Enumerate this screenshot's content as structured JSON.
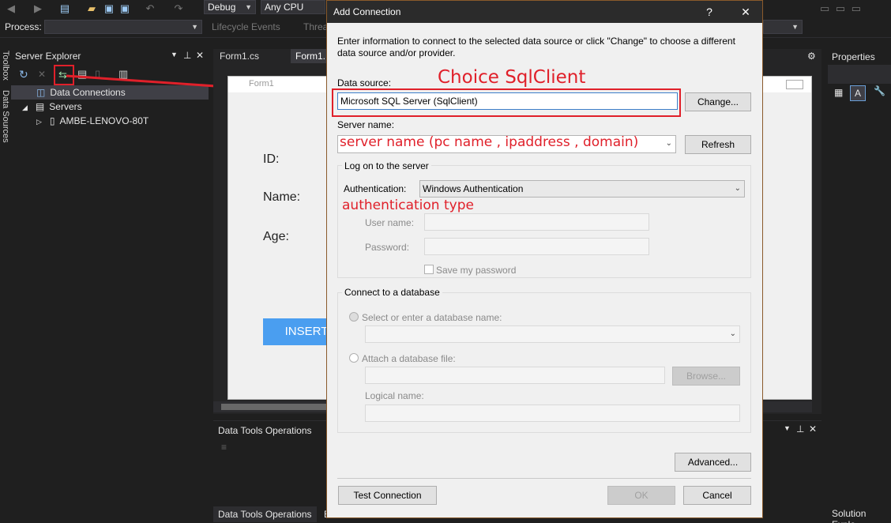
{
  "toolbar": {
    "config": "Debug",
    "platform": "Any CPU",
    "process_label": "Process:",
    "lifecycle": "Lifecycle Events",
    "thread": "Threa"
  },
  "sidebar": {
    "toolbox": "Toolbox",
    "data_sources": "Data Sources"
  },
  "server_explorer": {
    "title": "Server Explorer",
    "items": [
      {
        "label": "Data Connections"
      },
      {
        "label": "Servers"
      },
      {
        "label": "AMBE-LENOVO-80T"
      }
    ]
  },
  "designer": {
    "tabs": [
      "Form1.cs",
      "Form1."
    ],
    "form_title": "Form1",
    "labels": {
      "id": "ID:",
      "name": "Name:",
      "age": "Age:"
    },
    "insert_button": "INSERT"
  },
  "data_tools": {
    "title": "Data Tools Operations",
    "bottom_tab": "Data Tools Operations",
    "bottom_tab2": "E"
  },
  "properties": {
    "title": "Properties",
    "solution": "Solution Explo"
  },
  "dialog": {
    "title": "Add Connection",
    "help": "?",
    "close": "✕",
    "description": "Enter information to connect to the selected data source or click \"Change\" to choose a different data source and/or provider.",
    "data_source_label": "Data source:",
    "data_source_value": "Microsoft SQL Server (SqlClient)",
    "change_button": "Change...",
    "server_name_label": "Server name:",
    "refresh_button": "Refresh",
    "logon_group": "Log on to the server",
    "auth_label": "Authentication:",
    "auth_value": "Windows Authentication",
    "username_label": "User name:",
    "password_label": "Password:",
    "save_password": "Save my password",
    "connect_group": "Connect to a database",
    "select_db_label": "Select or enter a database name:",
    "attach_label": "Attach a database file:",
    "browse_button": "Browse...",
    "logical_name_label": "Logical name:",
    "advanced_button": "Advanced...",
    "test_button": "Test Connection",
    "ok_button": "OK",
    "cancel_button": "Cancel"
  },
  "annotations": {
    "sqlclient": "Choice SqlClient",
    "server_name_hint": "server name (pc name , ipaddress , domain)",
    "auth_hint": "authentication type"
  },
  "colors": {
    "annotation": "#e0202a",
    "accent": "#4a9ef0"
  }
}
